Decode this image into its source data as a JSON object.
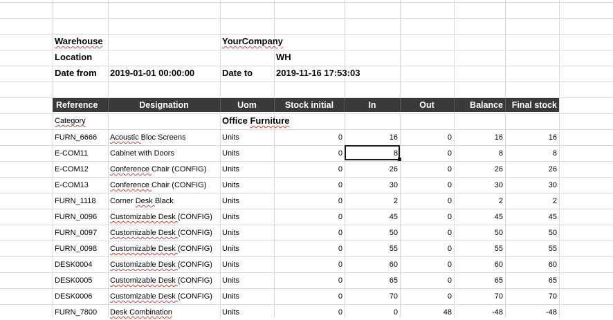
{
  "meta": {
    "warehouse_label": "Warehouse",
    "company": "YourCompany",
    "location_label": "Location",
    "location_value": "WH",
    "date_from_label": "Date from",
    "date_from_value": "2019-01-01 00:00:00",
    "date_to_label": "Date to",
    "date_to_value": "2019-11-16 17:53:03"
  },
  "columns": [
    "Reference",
    "Designation",
    "Uom",
    "Stock initial",
    "In",
    "Out",
    "Balance",
    "Final stock"
  ],
  "category": {
    "label": "Category",
    "value": "Office Furniture"
  },
  "rows": [
    {
      "ref": "FURN_6666",
      "designation": "Acoustic Bloc Screens",
      "uom": "Units",
      "initial": "0",
      "in": "16",
      "out": "0",
      "balance": "16",
      "final": "16"
    },
    {
      "ref": "E-COM11",
      "designation": "Cabinet with Doors",
      "uom": "Units",
      "initial": "0",
      "in": "8",
      "out": "0",
      "balance": "8",
      "final": "8"
    },
    {
      "ref": "E-COM12",
      "designation": "Conference Chair (CONFIG)",
      "uom": "Units",
      "initial": "0",
      "in": "26",
      "out": "0",
      "balance": "26",
      "final": "26"
    },
    {
      "ref": "E-COM13",
      "designation": "Conference Chair (CONFIG)",
      "uom": "Units",
      "initial": "0",
      "in": "30",
      "out": "0",
      "balance": "30",
      "final": "30"
    },
    {
      "ref": "FURN_1118",
      "designation": "Corner Desk Black",
      "uom": "Units",
      "initial": "0",
      "in": "2",
      "out": "0",
      "balance": "2",
      "final": "2"
    },
    {
      "ref": "FURN_0096",
      "designation": "Customizable Desk (CONFIG)",
      "uom": "Units",
      "initial": "0",
      "in": "45",
      "out": "0",
      "balance": "45",
      "final": "45"
    },
    {
      "ref": "FURN_0097",
      "designation": "Customizable Desk (CONFIG)",
      "uom": "Units",
      "initial": "0",
      "in": "50",
      "out": "0",
      "balance": "50",
      "final": "50"
    },
    {
      "ref": "FURN_0098",
      "designation": "Customizable Desk (CONFIG)",
      "uom": "Units",
      "initial": "0",
      "in": "55",
      "out": "0",
      "balance": "55",
      "final": "55"
    },
    {
      "ref": "DESK0004",
      "designation": "Customizable Desk (CONFIG)",
      "uom": "Units",
      "initial": "0",
      "in": "60",
      "out": "0",
      "balance": "60",
      "final": "60"
    },
    {
      "ref": "DESK0005",
      "designation": "Customizable Desk (CONFIG)",
      "uom": "Units",
      "initial": "0",
      "in": "65",
      "out": "0",
      "balance": "65",
      "final": "65"
    },
    {
      "ref": "DESK0006",
      "designation": "Customizable Desk (CONFIG)",
      "uom": "Units",
      "initial": "0",
      "in": "70",
      "out": "0",
      "balance": "70",
      "final": "70"
    },
    {
      "ref": "FURN_7800",
      "designation": "Desk Combination",
      "uom": "Units",
      "initial": "0",
      "in": "0",
      "out": "48",
      "balance": "-48",
      "final": "-48"
    }
  ]
}
